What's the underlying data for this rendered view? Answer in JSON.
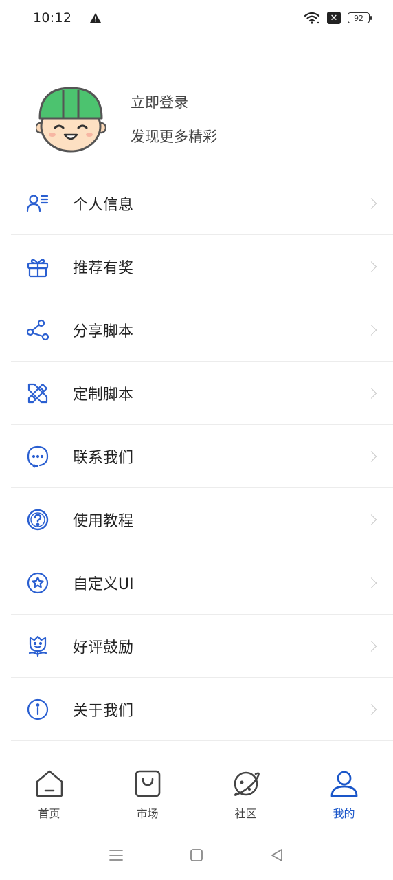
{
  "status_bar": {
    "time": "10:12",
    "battery": "92",
    "icons": [
      "warning-icon",
      "wifi-icon",
      "notification-x-icon",
      "battery-icon"
    ]
  },
  "profile": {
    "login_title": "立即登录",
    "login_subtitle": "发现更多精彩",
    "avatar": "worker-helmet-avatar"
  },
  "menu": {
    "items": [
      {
        "label": "个人信息",
        "icon": "user-info-icon"
      },
      {
        "label": "推荐有奖",
        "icon": "gift-icon"
      },
      {
        "label": "分享脚本",
        "icon": "share-icon"
      },
      {
        "label": "定制脚本",
        "icon": "pencil-ruler-icon"
      },
      {
        "label": "联系我们",
        "icon": "chat-icon"
      },
      {
        "label": "使用教程",
        "icon": "help-icon"
      },
      {
        "label": "自定义UI",
        "icon": "star-circle-icon"
      },
      {
        "label": "好评鼓励",
        "icon": "flower-icon"
      },
      {
        "label": "关于我们",
        "icon": "info-icon"
      }
    ]
  },
  "tabbar": {
    "tabs": [
      {
        "label": "首页",
        "icon": "home-icon",
        "active": false
      },
      {
        "label": "市场",
        "icon": "shopping-bag-icon",
        "active": false
      },
      {
        "label": "社区",
        "icon": "planet-icon",
        "active": false
      },
      {
        "label": "我的",
        "icon": "profile-icon",
        "active": true
      }
    ]
  },
  "colors": {
    "accent": "#1a56c9",
    "icon_blue": "#2a5fd1",
    "helmet_green": "#4cc36f",
    "divider": "#ececec"
  }
}
